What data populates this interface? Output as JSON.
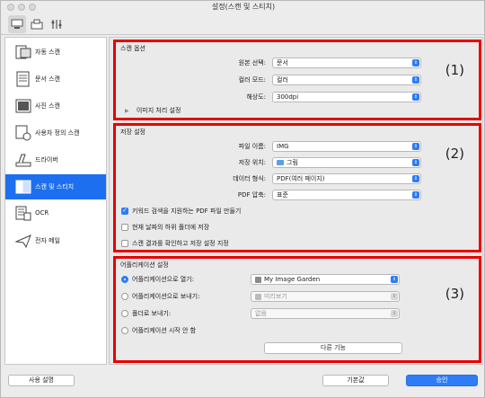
{
  "window": {
    "title": "설정(스캔 및 스티치)"
  },
  "sidebar": {
    "items": [
      {
        "label": "자동 스캔",
        "icon": "auto-scan-icon"
      },
      {
        "label": "문서 스캔",
        "icon": "document-scan-icon"
      },
      {
        "label": "사진 스캔",
        "icon": "photo-scan-icon"
      },
      {
        "label": "사용자 정의 스캔",
        "icon": "custom-scan-icon"
      },
      {
        "label": "드라이버",
        "icon": "driver-icon"
      },
      {
        "label": "스캔 및 스티치",
        "icon": "scan-stitch-icon",
        "active": true
      },
      {
        "label": "OCR",
        "icon": "ocr-icon"
      },
      {
        "label": "전자 메일",
        "icon": "email-icon"
      }
    ]
  },
  "scan_options": {
    "title": "스캔 옵션",
    "number": "(1)",
    "source_label": "원본 선택:",
    "source_value": "문서",
    "color_label": "컬러 모드:",
    "color_value": "컬러",
    "resolution_label": "해상도:",
    "resolution_value": "300dpi",
    "image_processing_label": "이미지 처리 설정"
  },
  "save_settings": {
    "title": "저장 설정",
    "number": "(2)",
    "filename_label": "파일 이름:",
    "filename_value": "IMG",
    "location_label": "저장 위치:",
    "location_value": "그림",
    "format_label": "데이터 형식:",
    "format_value": "PDF(여러 페이지)",
    "compression_label": "PDF 압축:",
    "compression_value": "표준",
    "check1": "키워드 검색을 지원하는 PDF 파일 만들기",
    "check1_on": true,
    "check2": "현재 날짜의 하위 폴더에 저장",
    "check3": "스캔 결과를 확인하고 저장 설정 지정"
  },
  "app_settings": {
    "title": "어플리케이션 설정",
    "number": "(3)",
    "radio1": "어플리케이션으로 열기:",
    "app_value": "My Image Garden",
    "radio2": "어플리케이션으로 보내기:",
    "send_value": "미리보기",
    "radio3": "폴더로 보내기:",
    "folder_value": "없음",
    "radio4": "어플리케이션 시작 안 함",
    "more_functions": "다른 기능"
  },
  "footer": {
    "instructions": "사용 설명",
    "defaults": "기본값",
    "ok": "승인"
  }
}
